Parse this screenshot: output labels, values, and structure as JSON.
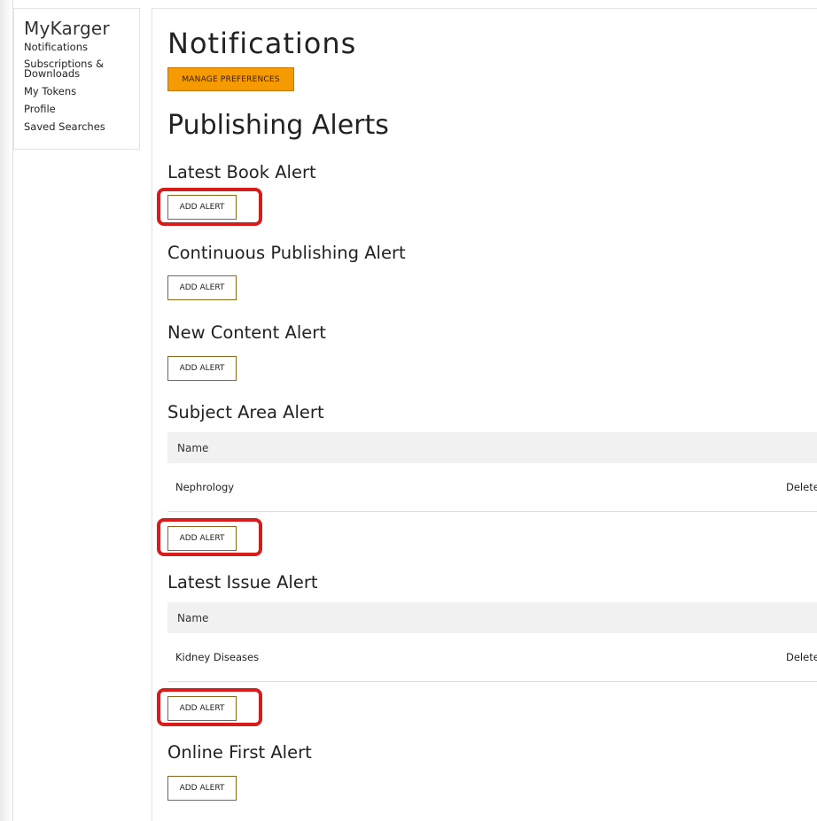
{
  "sidebar": {
    "title": "MyKarger",
    "items": [
      {
        "label": "Notifications"
      },
      {
        "label": "Subscriptions & Downloads"
      },
      {
        "label": "My Tokens"
      },
      {
        "label": "Profile"
      },
      {
        "label": "Saved Searches"
      }
    ]
  },
  "main": {
    "title": "Notifications",
    "manage_preferences_label": "MANAGE PREFERENCES",
    "section_title": "Publishing Alerts",
    "add_alert_label": "ADD ALERT",
    "alerts": [
      {
        "title": "Latest Book Alert"
      },
      {
        "title": "Continuous Publishing Alert"
      },
      {
        "title": "New Content Alert"
      },
      {
        "title": "Subject Area Alert",
        "table": {
          "header": "Name",
          "rows": [
            {
              "name": "Nephrology",
              "action": "Delete"
            }
          ]
        }
      },
      {
        "title": "Latest Issue Alert",
        "table": {
          "header": "Name",
          "rows": [
            {
              "name": "Kidney Diseases",
              "action": "Delete"
            }
          ]
        }
      },
      {
        "title": "Online First Alert"
      }
    ]
  },
  "colors": {
    "accent_orange": "#f59a00",
    "highlight_red": "#d71c1c",
    "button_border": "#8a6a1a",
    "table_header_bg": "#f1f1f1"
  }
}
